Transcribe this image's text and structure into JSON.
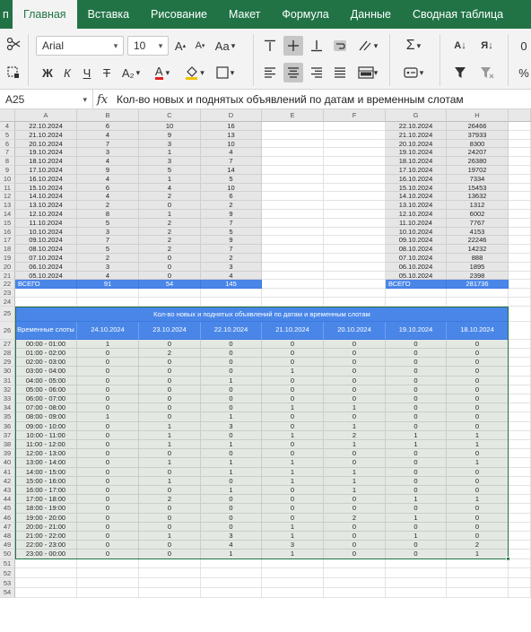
{
  "ribbon": {
    "tabs": [
      {
        "id": "file",
        "label": "п"
      },
      {
        "id": "home",
        "label": "Главная",
        "active": true
      },
      {
        "id": "insert",
        "label": "Вставка"
      },
      {
        "id": "draw",
        "label": "Рисование"
      },
      {
        "id": "layout",
        "label": "Макет"
      },
      {
        "id": "formula",
        "label": "Формула"
      },
      {
        "id": "data",
        "label": "Данные"
      },
      {
        "id": "pivot",
        "label": "Сводная таблица"
      }
    ]
  },
  "toolbar": {
    "font_name": "Arial",
    "font_size": "10",
    "bold_label": "Ж",
    "italic_label": "К",
    "underline_label": "Ч",
    "strike_label": "Ŧ",
    "subscript_label": "A₂",
    "font_color_label": "A",
    "grow_label": "A",
    "shrink_label": "A",
    "case_label": "Aa",
    "sum_label": "Σ",
    "sort_asc_label": "А↓",
    "sort_desc_label": "Я↓",
    "percent_label": "%",
    "cut_off_label": "0",
    "accent_color": "#217346",
    "font_color": "#e02020"
  },
  "formula_bar": {
    "cell_ref": "A25",
    "fx": "fx",
    "content": "Кол-во новых и поднятых объявлений по датам и временным слотам"
  },
  "columns": [
    "A",
    "B",
    "C",
    "D",
    "E",
    "F",
    "G",
    "H"
  ],
  "table1": {
    "rows": [
      {
        "r": "4",
        "date": "22.10.2024",
        "b": "6",
        "c": "10",
        "d": "16",
        "g": "22.10.2024",
        "h": "26466"
      },
      {
        "r": "5",
        "date": "21.10.2024",
        "b": "4",
        "c": "9",
        "d": "13",
        "g": "21.10.2024",
        "h": "37933"
      },
      {
        "r": "6",
        "date": "20.10.2024",
        "b": "7",
        "c": "3",
        "d": "10",
        "g": "20.10.2024",
        "h": "8300"
      },
      {
        "r": "7",
        "date": "19.10.2024",
        "b": "3",
        "c": "1",
        "d": "4",
        "g": "19.10.2024",
        "h": "24207"
      },
      {
        "r": "8",
        "date": "18.10.2024",
        "b": "4",
        "c": "3",
        "d": "7",
        "g": "18.10.2024",
        "h": "26380"
      },
      {
        "r": "9",
        "date": "17.10.2024",
        "b": "9",
        "c": "5",
        "d": "14",
        "g": "17.10.2024",
        "h": "19702"
      },
      {
        "r": "10",
        "date": "16.10.2024",
        "b": "4",
        "c": "1",
        "d": "5",
        "g": "16.10.2024",
        "h": "7334"
      },
      {
        "r": "11",
        "date": "15.10.2024",
        "b": "6",
        "c": "4",
        "d": "10",
        "g": "15.10.2024",
        "h": "15453"
      },
      {
        "r": "12",
        "date": "14.10.2024",
        "b": "4",
        "c": "2",
        "d": "6",
        "g": "14.10.2024",
        "h": "13632"
      },
      {
        "r": "13",
        "date": "13.10.2024",
        "b": "2",
        "c": "0",
        "d": "2",
        "g": "13.10.2024",
        "h": "1312"
      },
      {
        "r": "14",
        "date": "12.10.2024",
        "b": "8",
        "c": "1",
        "d": "9",
        "g": "12.10.2024",
        "h": "6002"
      },
      {
        "r": "15",
        "date": "11.10.2024",
        "b": "5",
        "c": "2",
        "d": "7",
        "g": "11.10.2024",
        "h": "7767"
      },
      {
        "r": "16",
        "date": "10.10.2024",
        "b": "3",
        "c": "2",
        "d": "5",
        "g": "10.10.2024",
        "h": "4153"
      },
      {
        "r": "17",
        "date": "09.10.2024",
        "b": "7",
        "c": "2",
        "d": "9",
        "g": "09.10.2024",
        "h": "22246"
      },
      {
        "r": "18",
        "date": "08.10.2024",
        "b": "5",
        "c": "2",
        "d": "7",
        "g": "08.10.2024",
        "h": "14232"
      },
      {
        "r": "19",
        "date": "07.10.2024",
        "b": "2",
        "c": "0",
        "d": "2",
        "g": "07.10.2024",
        "h": "888"
      },
      {
        "r": "20",
        "date": "06.10.2024",
        "b": "3",
        "c": "0",
        "d": "3",
        "g": "06.10.2024",
        "h": "1895"
      },
      {
        "r": "21",
        "date": "05.10.2024",
        "b": "4",
        "c": "0",
        "d": "4",
        "g": "05.10.2024",
        "h": "2398"
      }
    ],
    "total": {
      "r": "22",
      "label": "ВСЕГО",
      "b": "91",
      "c": "54",
      "d": "145",
      "g": "ВСЕГО",
      "h": "281736"
    }
  },
  "empty_rows_mid": [
    "23",
    "24"
  ],
  "table2": {
    "title": "Кол-во новых и поднятых объявлений по датам и временным слотам",
    "title_row": "25",
    "header_row": "26",
    "slot_header": "Временные слоты",
    "date_headers": [
      "24.10.2024",
      "23.10.2024",
      "22.10.2024",
      "21.10.2024",
      "20.10.2024",
      "19.10.2024",
      "18.10.2024"
    ],
    "rows": [
      {
        "r": "27",
        "slot": "00:00 - 01:00",
        "v": [
          "1",
          "0",
          "0",
          "0",
          "0",
          "0",
          "0"
        ]
      },
      {
        "r": "28",
        "slot": "01:00 - 02:00",
        "v": [
          "0",
          "2",
          "0",
          "0",
          "0",
          "0",
          "0"
        ]
      },
      {
        "r": "29",
        "slot": "02:00 - 03:00",
        "v": [
          "0",
          "0",
          "0",
          "0",
          "0",
          "0",
          "0"
        ]
      },
      {
        "r": "30",
        "slot": "03:00 - 04:00",
        "v": [
          "0",
          "0",
          "0",
          "1",
          "0",
          "0",
          "0"
        ]
      },
      {
        "r": "31",
        "slot": "04:00 - 05:00",
        "v": [
          "0",
          "0",
          "1",
          "0",
          "0",
          "0",
          "0"
        ]
      },
      {
        "r": "32",
        "slot": "05:00 - 06:00",
        "v": [
          "0",
          "0",
          "0",
          "0",
          "0",
          "0",
          "0"
        ]
      },
      {
        "r": "33",
        "slot": "06:00 - 07:00",
        "v": [
          "0",
          "0",
          "0",
          "0",
          "0",
          "0",
          "0"
        ]
      },
      {
        "r": "34",
        "slot": "07:00 - 08:00",
        "v": [
          "0",
          "0",
          "0",
          "1",
          "1",
          "0",
          "0"
        ]
      },
      {
        "r": "35",
        "slot": "08:00 - 09:00",
        "v": [
          "1",
          "0",
          "1",
          "0",
          "0",
          "0",
          "0"
        ]
      },
      {
        "r": "36",
        "slot": "09:00 - 10:00",
        "v": [
          "0",
          "1",
          "3",
          "0",
          "1",
          "0",
          "0"
        ]
      },
      {
        "r": "37",
        "slot": "10:00 - 11:00",
        "v": [
          "0",
          "1",
          "0",
          "1",
          "2",
          "1",
          "1"
        ]
      },
      {
        "r": "38",
        "slot": "11:00 - 12:00",
        "v": [
          "0",
          "1",
          "1",
          "0",
          "1",
          "1",
          "1"
        ]
      },
      {
        "r": "39",
        "slot": "12:00 - 13:00",
        "v": [
          "0",
          "0",
          "0",
          "0",
          "0",
          "0",
          "0"
        ]
      },
      {
        "r": "40",
        "slot": "13:00 - 14:00",
        "v": [
          "0",
          "1",
          "1",
          "1",
          "0",
          "0",
          "1"
        ]
      },
      {
        "r": "41",
        "slot": "14:00 - 15:00",
        "v": [
          "0",
          "0",
          "1",
          "1",
          "1",
          "0",
          "0"
        ]
      },
      {
        "r": "42",
        "slot": "15:00 - 16:00",
        "v": [
          "0",
          "1",
          "0",
          "1",
          "1",
          "0",
          "0"
        ]
      },
      {
        "r": "43",
        "slot": "16:00 - 17:00",
        "v": [
          "0",
          "0",
          "1",
          "0",
          "1",
          "0",
          "0"
        ]
      },
      {
        "r": "44",
        "slot": "17:00 - 18:00",
        "v": [
          "0",
          "2",
          "0",
          "0",
          "0",
          "1",
          "1"
        ]
      },
      {
        "r": "45",
        "slot": "18:00 - 19:00",
        "v": [
          "0",
          "0",
          "0",
          "0",
          "0",
          "0",
          "0"
        ]
      },
      {
        "r": "46",
        "slot": "19:00 - 20:00",
        "v": [
          "0",
          "0",
          "0",
          "0",
          "2",
          "1",
          "0"
        ]
      },
      {
        "r": "47",
        "slot": "20:00 - 21:00",
        "v": [
          "0",
          "0",
          "0",
          "1",
          "0",
          "0",
          "0"
        ]
      },
      {
        "r": "48",
        "slot": "21:00 - 22:00",
        "v": [
          "0",
          "1",
          "3",
          "1",
          "0",
          "1",
          "0"
        ]
      },
      {
        "r": "49",
        "slot": "22:00 - 23:00",
        "v": [
          "0",
          "0",
          "4",
          "3",
          "0",
          "0",
          "2"
        ]
      },
      {
        "r": "50",
        "slot": "23:00 - 00:00",
        "v": [
          "0",
          "0",
          "1",
          "1",
          "0",
          "0",
          "1"
        ]
      }
    ]
  },
  "empty_rows_bottom": [
    "51",
    "52",
    "53",
    "54"
  ],
  "colors": {
    "ribbon": "#217346",
    "header_blue": "#4a86e8",
    "table_fill": "#e3e8e3",
    "grey_fill": "#e6e6e6"
  }
}
